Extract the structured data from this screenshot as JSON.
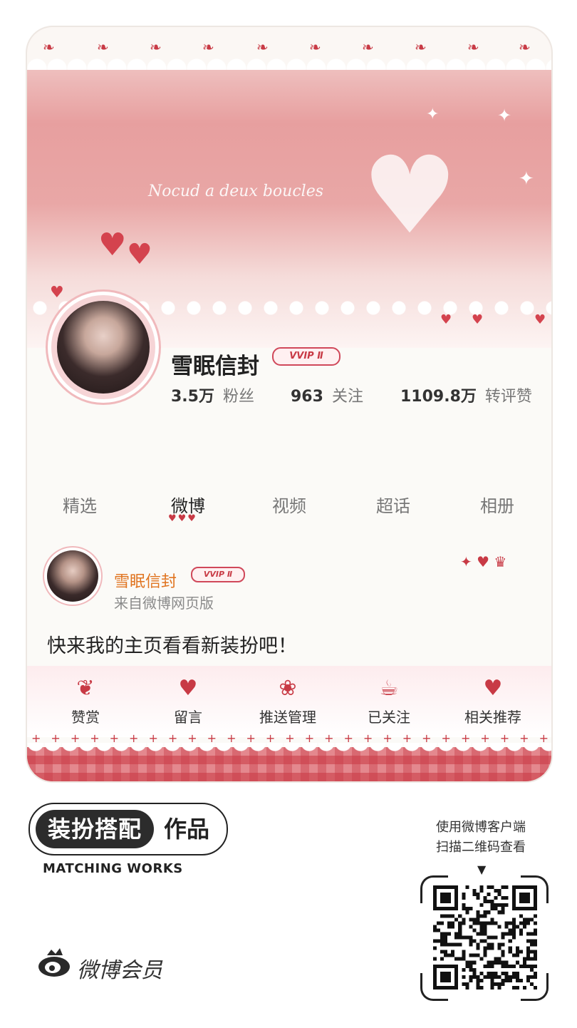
{
  "profile": {
    "name": "雪眠信封",
    "badge": "VVIP Ⅱ",
    "stats": [
      {
        "value": "3.5万",
        "label": "粉丝"
      },
      {
        "value": "963",
        "label": "关注"
      },
      {
        "value": "1109.8万",
        "label": "转评赞"
      }
    ]
  },
  "tabs": [
    {
      "label": "精选"
    },
    {
      "label": "微博"
    },
    {
      "label": "视频"
    },
    {
      "label": "超话"
    },
    {
      "label": "相册"
    }
  ],
  "active_tab": "微博",
  "post": {
    "author": "雪眠信封",
    "badge": "VVIP Ⅱ",
    "source": "来自微博网页版",
    "text": "快来我的主页看看新装扮吧！"
  },
  "actions": [
    {
      "label": "赞赏"
    },
    {
      "label": "留言"
    },
    {
      "label": "推送管理"
    },
    {
      "label": "已关注"
    },
    {
      "label": "相关推荐"
    }
  ],
  "banner_text": "Nocud a deux boucles",
  "footer": {
    "badge_left": "装扮搭配",
    "badge_right": "作品",
    "subtitle": "MATCHING WORKS",
    "brand": "微博会员",
    "scan_line1": "使用微博客户端",
    "scan_line2": "扫描二维码查看"
  },
  "colors": {
    "accent": "#c83a45",
    "author_name": "#e07420",
    "banner_pink": "#e79f9f"
  }
}
